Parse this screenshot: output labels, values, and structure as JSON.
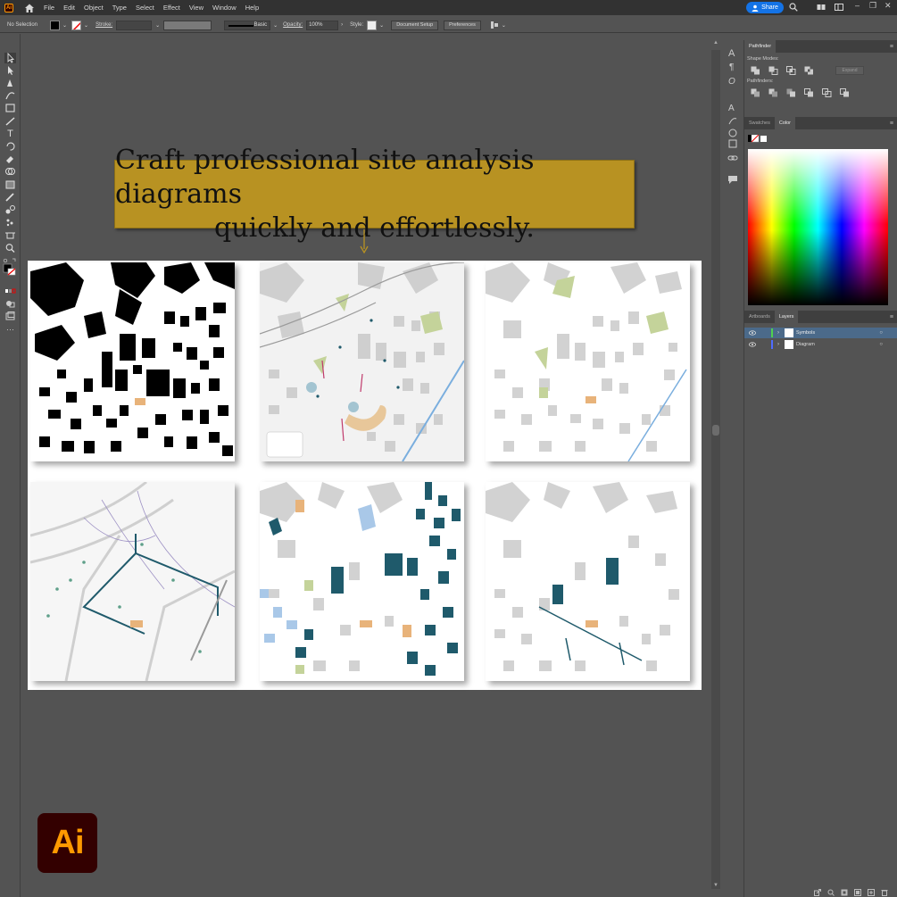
{
  "app": {
    "badge": "Ai",
    "logo_text": "Ai"
  },
  "menu": [
    "File",
    "Edit",
    "Object",
    "Type",
    "Select",
    "Effect",
    "View",
    "Window",
    "Help"
  ],
  "header": {
    "share_label": "Share"
  },
  "control_bar": {
    "selection": "No Selection",
    "stroke_label": "Stroke:",
    "brush_label": "Basic",
    "opacity_label": "Opacity:",
    "opacity_value": "100%",
    "style_label": "Style:",
    "document_setup": "Document Setup",
    "preferences": "Preferences"
  },
  "callout": {
    "line1": "Craft professional site analysis diagrams",
    "line2": "quickly and effortlessly."
  },
  "panels": {
    "pathfinder": {
      "tab": "Pathfinder",
      "shape_modes": "Shape Modes:",
      "pathfinders": "Pathfinders:",
      "expand": "Expand"
    },
    "color": {
      "tabs": [
        "Swatches",
        "Color"
      ],
      "active": "Color"
    },
    "layers": {
      "tabs": [
        "Artboards",
        "Layers"
      ],
      "active": "Layers",
      "items": [
        {
          "name": "Symbols",
          "color": "#4fd14f"
        },
        {
          "name": "Diagram",
          "color": "#4f6cff"
        }
      ]
    }
  },
  "colors": {
    "accent": "#1473e6",
    "callout_bg": "#b89222",
    "teal": "#1f5a6b",
    "orange": "#e8b37a",
    "green": "#c4d39a"
  }
}
